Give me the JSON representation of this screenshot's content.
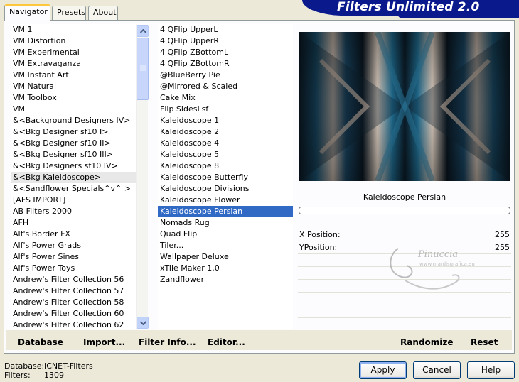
{
  "app": {
    "title": "Filters Unlimited 2.0"
  },
  "tabs": [
    {
      "label": "Navigator"
    },
    {
      "label": "Presets"
    },
    {
      "label": "About"
    }
  ],
  "categories": [
    "VM 1",
    "VM Distortion",
    "VM Experimental",
    "VM Extravaganza",
    "VM Instant Art",
    "VM Natural",
    "VM Toolbox",
    "VM",
    "&<Background Designers IV>",
    "&<Bkg Designer sf10 I>",
    "&<Bkg Designer sf10 II>",
    "&<Bkg Designer sf10 III>",
    "&<Bkg Designers sf10 IV>",
    "&<Bkg Kaleidoscope>",
    "&<Sandflower Specials^v^ >",
    "[AFS IMPORT]",
    "AB Filters 2000",
    "AFH",
    "Alf's Border FX",
    "Alf's Power Grads",
    "Alf's Power Sines",
    "Alf's Power Toys",
    "Andrew's Filter Collection 56",
    "Andrew's Filter Collection 57",
    "Andrew's Filter Collection 58",
    "Andrew's Filter Collection 60",
    "Andrew's Filter Collection 62"
  ],
  "selected_category": "&<Bkg Kaleidoscope>",
  "filters": [
    "4 QFlip UpperL",
    "4 QFlip UpperR",
    "4 QFlip ZBottomL",
    "4 QFlip ZBottomR",
    "@BlueBerry Pie",
    "@Mirrored & Scaled",
    "Cake Mix",
    "Flip SidesLsf",
    "Kaleidoscope 1",
    "Kaleidoscope 2",
    "Kaleidoscope 4",
    "Kaleidoscope 5",
    "Kaleidoscope 8",
    "Kaleidoscope Butterfly",
    "Kaleidoscope Divisions",
    "Kaleidoscope Flower",
    "Kaleidoscope Persian",
    "Nomads Rug",
    "Quad Flip",
    "Tiler...",
    "Wallpaper Deluxe",
    "xTile Maker 1.0",
    "Zandflower"
  ],
  "selected_filter": "Kaleidoscope Persian",
  "preview": {
    "filter_name": "Kaleidoscope Persian",
    "progress": 0
  },
  "params": [
    {
      "label": "X Position:",
      "value": "255"
    },
    {
      "label": "YPosition:",
      "value": "255"
    }
  ],
  "watermark": {
    "text": "Pinuccia",
    "url": "www.mardisgrafica.eu"
  },
  "actions": {
    "database": "Database",
    "import": "Import...",
    "filter_info": "Filter Info...",
    "editor": "Editor...",
    "randomize": "Randomize",
    "reset": "Reset"
  },
  "status": {
    "database_label": "Database:",
    "database_value": "ICNET-Filters",
    "filters_label": "Filters:",
    "filters_value": "1309"
  },
  "buttons": {
    "apply": "Apply",
    "cancel": "Cancel",
    "help": "Help"
  },
  "colors": {
    "banner": "#0a1a8c",
    "selection": "#316ac5",
    "panel_bg": "#ece9d8"
  }
}
